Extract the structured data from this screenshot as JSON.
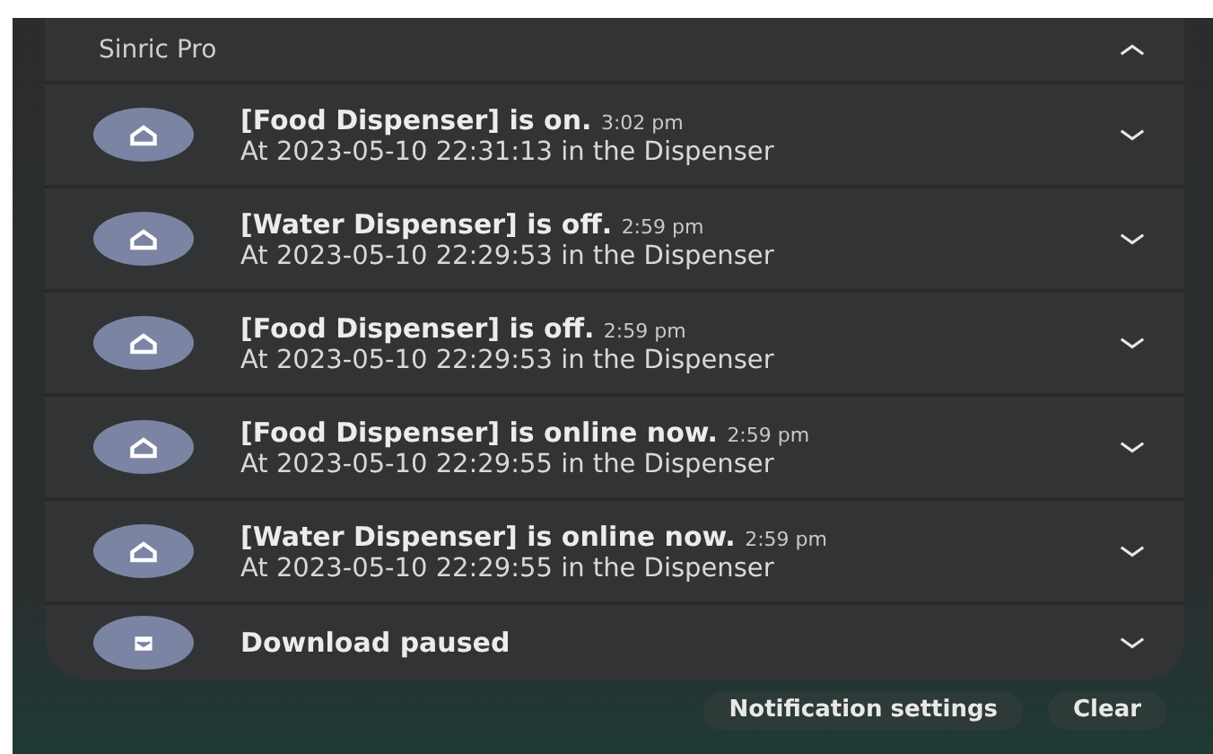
{
  "group": {
    "app_name": "Sinric Pro",
    "expanded": true,
    "notifications": [
      {
        "title": "[Food Dispenser] is on.",
        "time": "3:02 pm",
        "text": "At 2023-05-10 22:31:13 in the Dispenser"
      },
      {
        "title": "[Water Dispenser] is off.",
        "time": "2:59 pm",
        "text": "At 2023-05-10 22:29:53 in the Dispenser"
      },
      {
        "title": "[Food Dispenser] is off.",
        "time": "2:59 pm",
        "text": "At 2023-05-10 22:29:53 in the Dispenser"
      },
      {
        "title": "[Food Dispenser] is online now.",
        "time": "2:59 pm",
        "text": "At 2023-05-10 22:29:55 in the Dispenser"
      },
      {
        "title": "[Water Dispenser] is online now.",
        "time": "2:59 pm",
        "text": "At 2023-05-10 22:29:55 in the Dispenser"
      }
    ]
  },
  "download": {
    "title": "Download paused"
  },
  "buttons": [
    "Notification settings",
    "Clear"
  ]
}
